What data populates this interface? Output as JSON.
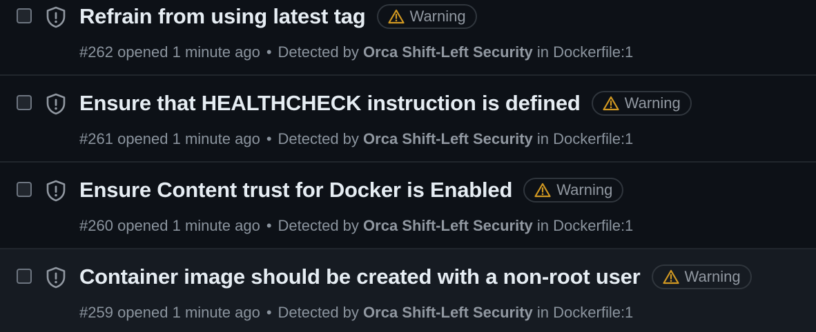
{
  "alerts": [
    {
      "title": "Refrain from using latest tag",
      "severity": "Warning",
      "number": "#262",
      "opened": "opened 1 minute ago",
      "detected_prefix": "Detected by",
      "source": "Orca Shift-Left Security",
      "location_prefix": "in",
      "location": "Dockerfile:1"
    },
    {
      "title": "Ensure that HEALTHCHECK instruction is defined",
      "severity": "Warning",
      "number": "#261",
      "opened": "opened 1 minute ago",
      "detected_prefix": "Detected by",
      "source": "Orca Shift-Left Security",
      "location_prefix": "in",
      "location": "Dockerfile:1"
    },
    {
      "title": "Ensure Content trust for Docker is Enabled",
      "severity": "Warning",
      "number": "#260",
      "opened": "opened 1 minute ago",
      "detected_prefix": "Detected by",
      "source": "Orca Shift-Left Security",
      "location_prefix": "in",
      "location": "Dockerfile:1"
    },
    {
      "title": "Container image should be created with a non-root user",
      "severity": "Warning",
      "number": "#259",
      "opened": "opened 1 minute ago",
      "detected_prefix": "Detected by",
      "source": "Orca Shift-Left Security",
      "location_prefix": "in",
      "location": "Dockerfile:1"
    }
  ],
  "colors": {
    "background": "#0d1117",
    "hover_row": "#161b22",
    "warning": "#d29922",
    "text_primary": "#e6edf3",
    "text_muted": "#8b949e"
  },
  "icons": {
    "row_icon": "shield-icon",
    "badge_icon": "alert-triangle-icon"
  }
}
